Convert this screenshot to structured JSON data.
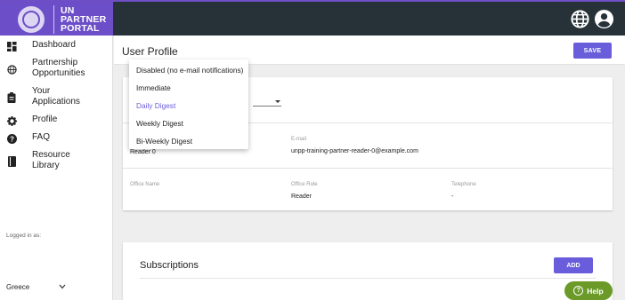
{
  "brand": {
    "line1": "UN",
    "line2": "PARTNER",
    "line3": "PORTAL"
  },
  "topbar": {
    "icons": [
      "globe-icon",
      "account-icon"
    ]
  },
  "sidebar": {
    "items": [
      {
        "label": "Dashboard",
        "icon": "dashboard-icon"
      },
      {
        "label": "Partnership Opportunities",
        "icon": "globe-icon"
      },
      {
        "label": "Your Applications",
        "icon": "clipboard-icon"
      },
      {
        "label": "Profile",
        "icon": "gear-icon"
      },
      {
        "label": "FAQ",
        "icon": "help-circle-icon"
      },
      {
        "label": "Resource Library",
        "icon": "book-icon"
      }
    ],
    "logged_in_label": "Logged in as:",
    "country": "Greece"
  },
  "header": {
    "title": "User Profile",
    "save_label": "SAVE"
  },
  "profile": {
    "name_value": "Reader 0",
    "email_label": "E-mail",
    "email_value": "unpp-training-partner-reader-0@example.com",
    "office_name_label": "Office Name",
    "office_role_label": "Office Role",
    "office_role_value": "Reader",
    "telephone_label": "Telephone",
    "telephone_value": "-"
  },
  "subscriptions": {
    "title": "Subscriptions",
    "add_label": "ADD"
  },
  "dropdown": {
    "options": [
      "Disabled (no e-mail notifications)",
      "Immediate",
      "Daily Digest",
      "Weekly Digest",
      "Bi-Weekly Digest"
    ],
    "selected": "Daily Digest"
  },
  "help": {
    "label": "Help"
  },
  "colors": {
    "accent": "#6a5ddc",
    "brand": "#6c4fc8",
    "topbar": "#263238",
    "help": "#6b9a28"
  }
}
